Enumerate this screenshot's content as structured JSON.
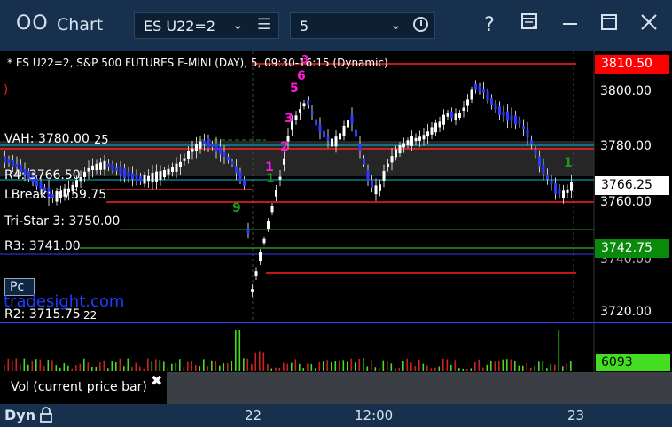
{
  "window": {
    "title": "Chart",
    "app_icon": "double-circle-icon",
    "symbol": "ES U22=2",
    "interval": "5",
    "buttons": [
      "help-icon",
      "template-icon",
      "minimize-icon",
      "maximize-icon",
      "close-icon"
    ],
    "help_label": "?"
  },
  "chart": {
    "header": "* ES U22=2, S&P 500 FUTURES E-MINI (DAY), 5, 09:30-16:15 (Dynamic)",
    "price_axis": [
      "3800.00",
      "3780.00",
      "3760.00",
      "3720.00"
    ],
    "price_axis_partial": "3740.00",
    "badges": {
      "top": "3810.50",
      "current": "3766.25",
      "green": "3742.75"
    },
    "levels": {
      "vah": "VAH: 3780.00",
      "vah_suffix": "25",
      "r4": "R4: 3766.50",
      "lbreak": "LBreak: 3759.75",
      "tristar": "Tri-Star 3: 3750.00",
      "r3": "R3: 3741.00",
      "r2": "R2: 3715.75",
      "r2_suffix": "22"
    },
    "pc_button": "Pc",
    "watermark": "tradesight.com",
    "markers_magenta": [
      "6",
      "5",
      "3",
      "2",
      "1",
      "3"
    ],
    "markers_green": [
      "1",
      "9",
      "1"
    ],
    "left_marker": ")",
    "colors": {
      "red": "#ff2020",
      "cyan": "#00c8ff",
      "green": "#1a9a1a",
      "up": "#ffffff",
      "down": "#2a3cff",
      "magenta": "#ff19d9"
    }
  },
  "volume": {
    "label": "Vol (current price bar)",
    "value": "6093"
  },
  "time_axis": [
    "22",
    "12:00",
    "23"
  ],
  "footer": {
    "dyn": "Dyn"
  }
}
